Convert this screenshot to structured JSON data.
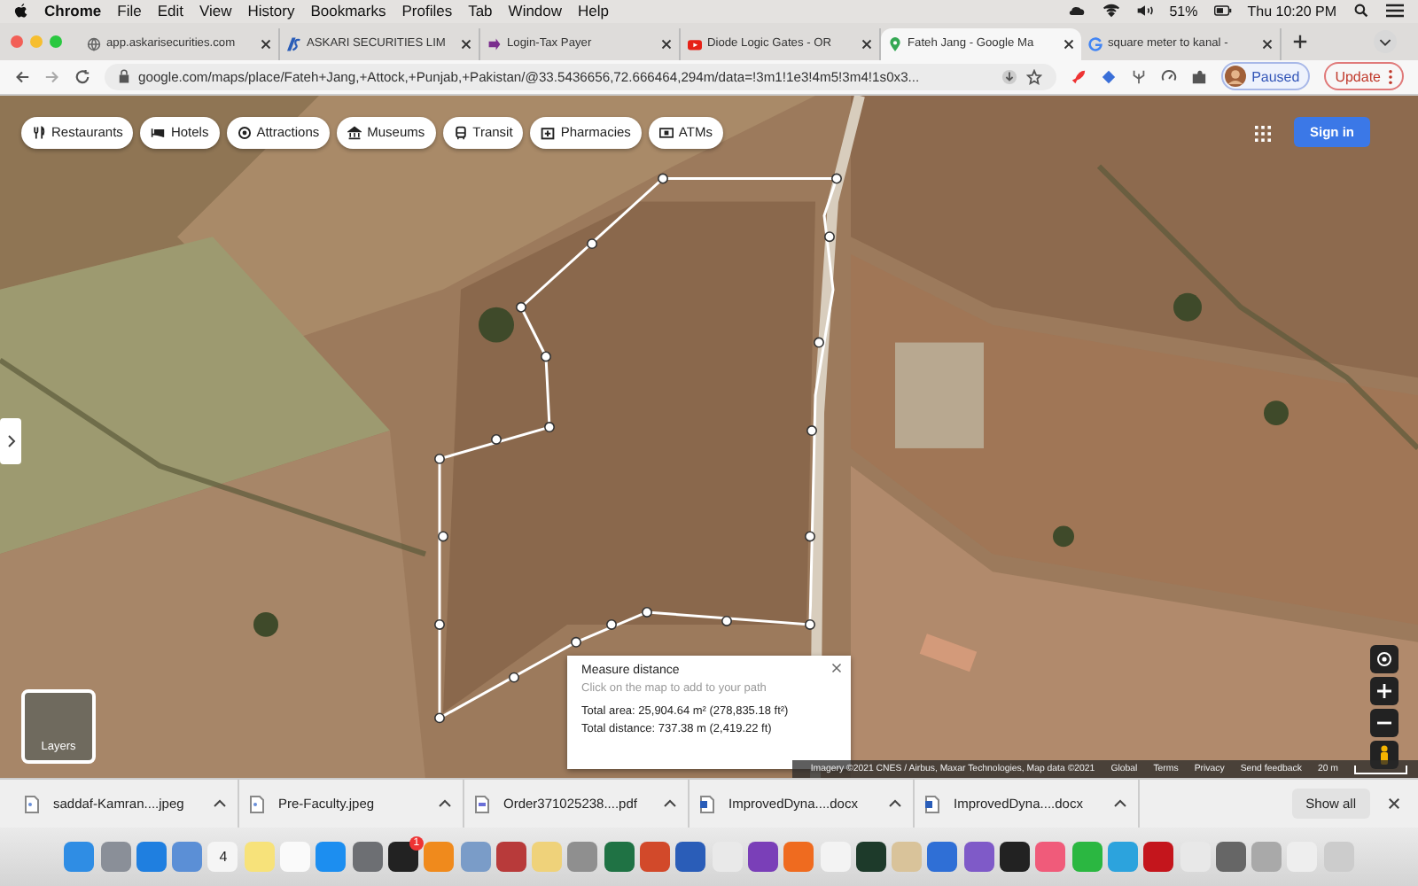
{
  "menu_bar": {
    "app": "Chrome",
    "menus": [
      "File",
      "Edit",
      "View",
      "History",
      "Bookmarks",
      "Profiles",
      "Tab",
      "Window",
      "Help"
    ],
    "battery": "51%",
    "clock": "Thu 10:20 PM"
  },
  "tabs": [
    {
      "title": "app.askarisecurities.com",
      "kind": "globe",
      "selected": false
    },
    {
      "title": "ASKARI SECURITIES LIM",
      "kind": "askari",
      "selected": false
    },
    {
      "title": "Login-Tax Payer",
      "kind": "tax",
      "selected": false
    },
    {
      "title": "Diode Logic Gates - OR",
      "kind": "video",
      "selected": false
    },
    {
      "title": "Fateh Jang - Google Ma",
      "kind": "pin",
      "selected": true
    },
    {
      "title": "square meter to kanal -",
      "kind": "google",
      "selected": false
    }
  ],
  "address_bar": {
    "url": "google.com/maps/place/Fateh+Jang,+Attock,+Punjab,+Pakistan/@33.5436656,72.666464,294m/data=!3m1!1e3!4m5!3m4!1s0x3...",
    "profile": "Paused",
    "update": "Update"
  },
  "map": {
    "chips": [
      {
        "label": "Restaurants",
        "kind": "fork"
      },
      {
        "label": "Hotels",
        "kind": "bed"
      },
      {
        "label": "Attractions",
        "kind": "camera"
      },
      {
        "label": "Museums",
        "kind": "museum"
      },
      {
        "label": "Transit",
        "kind": "bus"
      },
      {
        "label": "Pharmacies",
        "kind": "pharmacy"
      },
      {
        "label": "ATMs",
        "kind": "atm"
      }
    ],
    "sign_in": "Sign in",
    "layers": "Layers",
    "measure": {
      "title": "Measure distance",
      "hint": "Click on the map to add to your path",
      "area": "Total area: 25,904.64 m² (278,835.18 ft²)",
      "distance": "Total distance: 737.38 m (2,419.22 ft)"
    },
    "attribution": [
      "Imagery ©2021 CNES / Airbus, Maxar Technologies, Map data ©2021",
      "Global",
      "Terms",
      "Privacy",
      "Send feedback"
    ],
    "scale": "20 m"
  },
  "downloads": {
    "files": [
      {
        "name": "saddaf-Kamran....jpeg",
        "kind": "image"
      },
      {
        "name": "Pre-Faculty.jpeg",
        "kind": "image"
      },
      {
        "name": "Order371025238....pdf",
        "kind": "pdf"
      },
      {
        "name": "ImprovedDyna....docx",
        "kind": "doc"
      },
      {
        "name": "ImprovedDyna....docx",
        "kind": "doc"
      }
    ],
    "show_all": "Show all"
  },
  "dock": {
    "calendar_day": "4",
    "badge": "1"
  }
}
